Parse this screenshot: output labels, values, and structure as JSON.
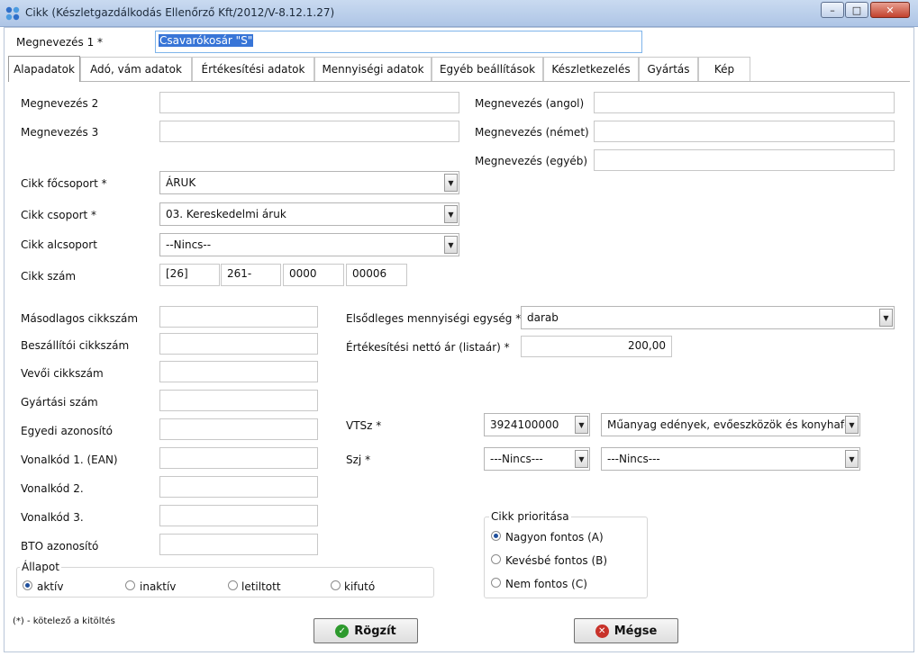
{
  "window": {
    "title": "Cikk (Készletgazdálkodás Ellenőrző Kft/2012/V-8.12.1.27)",
    "minimize": "–",
    "maximize": "□",
    "close": "✕"
  },
  "header": {
    "name1_label": "Megnevezés 1 *",
    "name1_value": "Csavarókosár \"S\""
  },
  "tabs": [
    {
      "label": "Alapadatok"
    },
    {
      "label": "Adó, vám adatok"
    },
    {
      "label": "Értékesítési adatok"
    },
    {
      "label": "Mennyiségi adatok"
    },
    {
      "label": "Egyéb beállítások"
    },
    {
      "label": "Készletkezelés"
    },
    {
      "label": "Gyártás"
    },
    {
      "label": "Kép"
    }
  ],
  "names": {
    "name2_label": "Megnevezés 2",
    "name2_value": "",
    "name3_label": "Megnevezés 3",
    "name3_value": "",
    "english_label": "Megnevezés (angol)",
    "english_value": "",
    "german_label": "Megnevezés (német)",
    "german_value": "",
    "other_label": "Megnevezés (egyéb)",
    "other_value": ""
  },
  "groups": {
    "main_label": "Cikk főcsoport *",
    "main_value": "ÁRUK",
    "group_label": "Cikk csoport *",
    "group_value": "03. Kereskedelmi áruk",
    "sub_label": "Cikk alcsoport",
    "sub_value": "--Nincs--",
    "number_label": "Cikk szám",
    "number_parts": [
      "[26]",
      "261-",
      "0000",
      "00006"
    ]
  },
  "codes": {
    "secondary": {
      "label": "Másodlagos cikkszám",
      "value": ""
    },
    "supplier": {
      "label": "Beszállítói cikkszám",
      "value": ""
    },
    "customer": {
      "label": "Vevői cikkszám",
      "value": ""
    },
    "production": {
      "label": "Gyártási szám",
      "value": ""
    },
    "unique": {
      "label": "Egyedi azonosító",
      "value": ""
    },
    "barcode1": {
      "label": "Vonalkód 1. (EAN)",
      "value": ""
    },
    "barcode2": {
      "label": "Vonalkód 2.",
      "value": ""
    },
    "barcode3": {
      "label": "Vonalkód 3.",
      "value": ""
    },
    "bto": {
      "label": "BTO azonosító",
      "value": ""
    }
  },
  "unit": {
    "label": "Elsődleges mennyiségi egység *",
    "value": "darab"
  },
  "price": {
    "label": "Értékesítési nettó ár (listaár) *",
    "value": "200,00"
  },
  "vtsz": {
    "label": "VTSz *",
    "code": "3924100000",
    "description": "Műanyag edények, evőeszközök és konyhafel"
  },
  "szj": {
    "label": "Szj *",
    "code": "---Nincs---",
    "description": "---Nincs---"
  },
  "priority": {
    "legend": "Cikk prioritása",
    "options": [
      "Nagyon fontos  (A)",
      "Kevésbé fontos  (B)",
      "Nem fontos  (C)"
    ],
    "selected": 0
  },
  "status": {
    "legend": "Állapot",
    "options": [
      "aktív",
      "inaktív",
      "letiltott",
      "kifutó"
    ],
    "selected": 0
  },
  "footer": {
    "note": "(*) - kötelező a kitöltés",
    "save_label": "Rögzít",
    "cancel_label": "Mégse"
  },
  "colors": {
    "accent": "#1f4f9c",
    "save_icon": "#2e9a2e",
    "cancel_icon": "#c8322a",
    "selection": "#3875d7"
  }
}
